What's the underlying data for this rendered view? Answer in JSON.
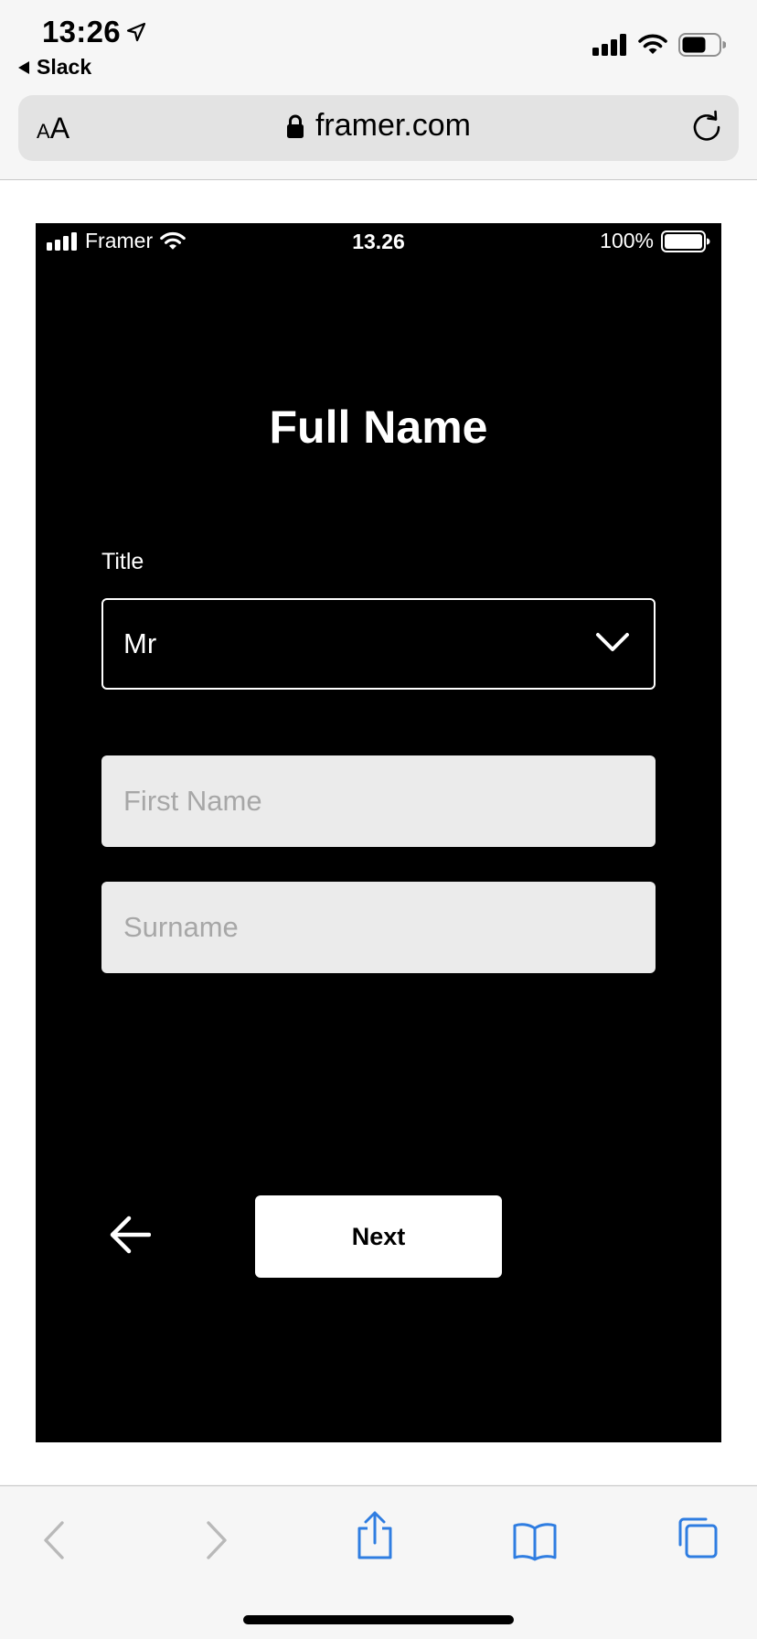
{
  "ios_status": {
    "time": "13:26",
    "back_app": "Slack"
  },
  "browser": {
    "text_size_small": "A",
    "text_size_large": "A",
    "url": "framer.com"
  },
  "prototype": {
    "status": {
      "carrier": "Framer",
      "time": "13.26",
      "battery": "100%"
    },
    "heading": "Full Name",
    "title_label": "Title",
    "title_value": "Mr",
    "first_name_placeholder": "First Name",
    "surname_placeholder": "Surname",
    "next_label": "Next"
  },
  "icons": {
    "location": "location-arrow-icon",
    "signal": "cellular-signal-icon",
    "wifi": "wifi-icon",
    "battery": "battery-icon",
    "lock": "lock-icon",
    "reload": "reload-icon",
    "chevron": "chevron-down-icon",
    "back_arrow": "arrow-left-icon",
    "toolbar": [
      "chevron-left-icon",
      "chevron-right-icon",
      "share-icon",
      "bookmarks-icon",
      "tabs-icon"
    ]
  },
  "colors": {
    "toolbar_icon_active": "#2f7de1",
    "toolbar_icon_disabled": "#b9b9b9",
    "field_background": "#ebebeb",
    "placeholder": "#a7a7a7"
  }
}
